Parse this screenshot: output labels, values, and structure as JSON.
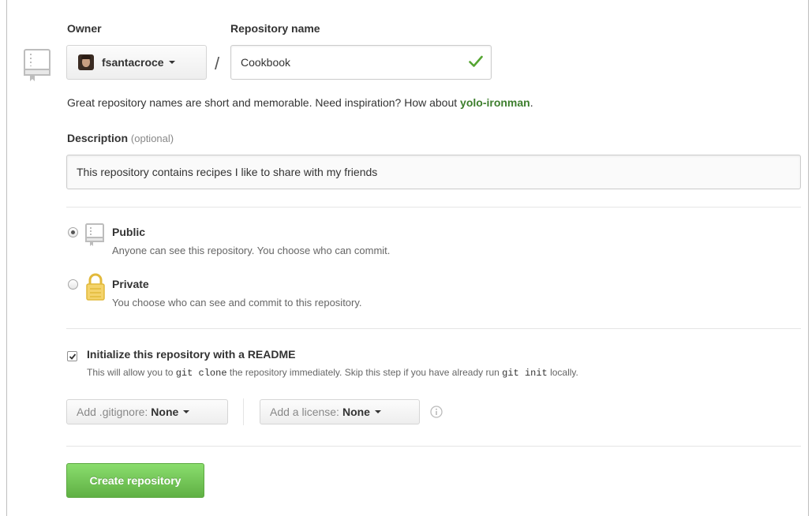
{
  "form": {
    "owner_label": "Owner",
    "repo_name_label": "Repository name",
    "owner": {
      "name": "fsantacroce"
    },
    "slash": "/",
    "repo_name_value": "Cookbook",
    "hint_text": "Great repository names are short and memorable. Need inspiration? How about ",
    "hint_suggestion": "yolo-ironman",
    "hint_end": ".",
    "description_label": "Description",
    "description_optional": "(optional)",
    "description_value": "This repository contains recipes I like to share with my friends"
  },
  "visibility": {
    "public": {
      "title": "Public",
      "desc": "Anyone can see this repository. You choose who can commit.",
      "selected": true
    },
    "private": {
      "title": "Private",
      "desc": "You choose who can see and commit to this repository.",
      "selected": false
    }
  },
  "readme": {
    "checked": true,
    "title": "Initialize this repository with a README",
    "desc_1": "This will allow you to ",
    "code_1": "git clone",
    "desc_2": " the repository immediately. Skip this step if you have already run ",
    "code_2": "git init",
    "desc_3": " locally."
  },
  "gitignore": {
    "label": "Add .gitignore:",
    "value": "None"
  },
  "license": {
    "label": "Add a license:",
    "value": "None"
  },
  "create_button": "Create repository",
  "colors": {
    "accent_green": "#60b044",
    "suggestion_green": "#3d7e2d",
    "check_green": "#55a532",
    "lock_yellow": "#f4d36b"
  },
  "icons": [
    "repo-icon",
    "check-icon",
    "repo-icon",
    "lock-icon",
    "info-icon",
    "caret-down-icon"
  ]
}
